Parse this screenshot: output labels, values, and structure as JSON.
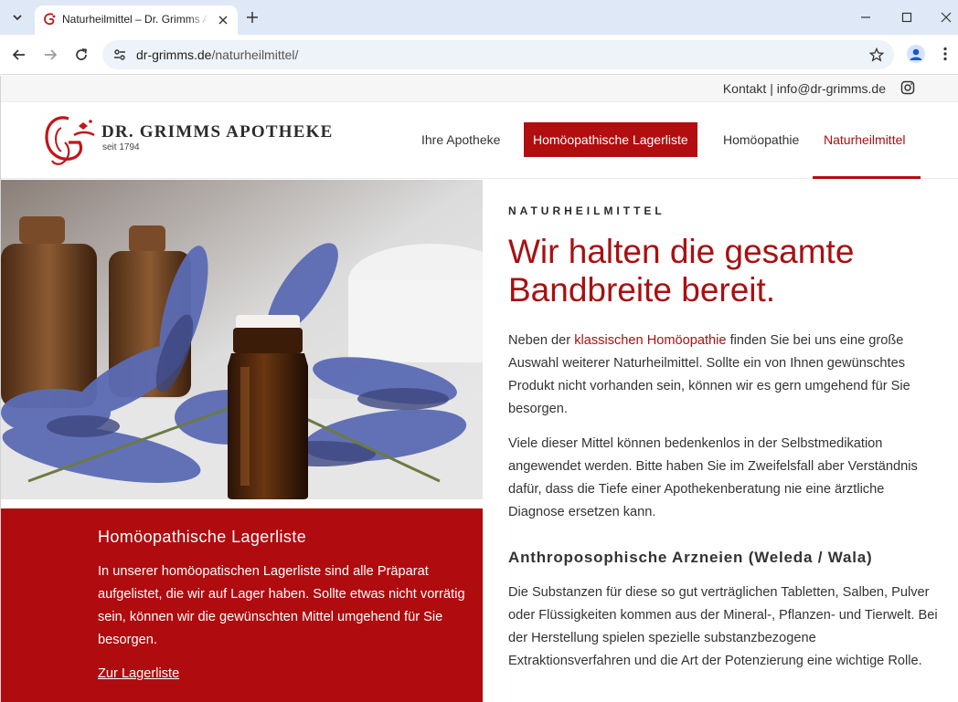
{
  "browser": {
    "tab_title": "Naturheilmittel – Dr. Grimms Apotheke",
    "url_domain": "dr-grimms.de",
    "url_path": "/naturheilmittel/",
    "icons": [
      "tab-search-icon",
      "close-icon",
      "plus-icon",
      "minimize-icon",
      "maximize-icon",
      "window-close-icon",
      "back-icon",
      "forward-icon",
      "reload-icon",
      "site-info-icon",
      "star-icon",
      "profile-icon",
      "kebab-menu-icon"
    ]
  },
  "topbar": {
    "contact_label": "Kontakt",
    "separator": " | ",
    "email": "info@dr-grimms.de",
    "social_icon": "instagram-icon"
  },
  "header": {
    "logo_name": "DR. GRIMMS APOTHEKE",
    "logo_sub": "seit 1794",
    "nav": [
      {
        "label": "Ihre Apotheke"
      },
      {
        "label": "Homöopathische Lagerliste"
      },
      {
        "label": "Homöopathie"
      },
      {
        "label": "Naturheilmittel"
      }
    ]
  },
  "sidebar": {
    "title": "Homöopathische Lagerliste",
    "text": "In unserer homöopatischen Lagerliste sind alle Präparat aufgelistet, die wir auf Lager haben. Sollte etwas nicht vorrätig sein, können wir die gewünschten Mittel umgehend für Sie besorgen.",
    "link": "Zur Lagerliste"
  },
  "main": {
    "eyebrow": "NATURHEILMITTEL",
    "headline": "Wir halten die gesamte Bandbreite bereit.",
    "p1_before": "Neben der ",
    "p1_link": "klassischen Homöopathie",
    "p1_after": " finden Sie bei uns eine große Auswahl weiterer Naturheilmittel. Sollte ein von Ihnen gewünschtes Produkt nicht vorhanden sein, können wir es gern umgehend für Sie besorgen.",
    "p2": "Viele dieser Mittel können bedenkenlos  in der Selbstmedikation angewendet werden. Bitte haben Sie im Zweifelsfall aber Verständnis dafür, dass die Tiefe einer Apothekenberatung nie eine ärztliche Diagnose ersetzen kann.",
    "subhead": "Anthroposophische Arzneien (Weleda / Wala)",
    "p3": "Die Substanzen für diese so gut verträglichen Tabletten, Salben, Pulver oder Flüssigkeiten kommen aus der Mineral-, Pflanzen- und Tierwelt. Bei der Herstellung spielen spezielle substanzbezogene Extraktionsverfahren und die Art der Potenzierung eine wichtige Rolle."
  },
  "colors": {
    "brand_red": "#b20d0f",
    "tab_strip": "#dfe8f6",
    "omnibox": "#eef2f9"
  }
}
